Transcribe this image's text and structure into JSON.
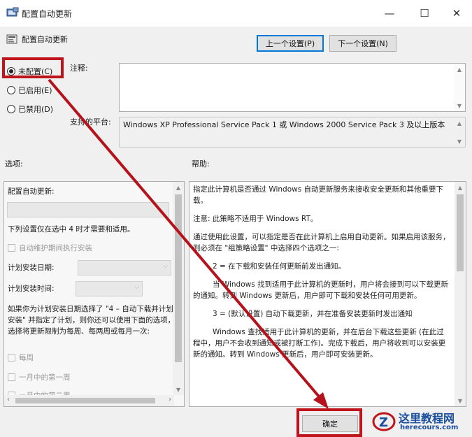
{
  "window": {
    "title": "配置自动更新",
    "minimize": "—",
    "maximize": "☐",
    "close": "✕"
  },
  "header": {
    "title": "配置自动更新",
    "prev_button": "上一个设置(P)",
    "next_button": "下一个设置(N)"
  },
  "state": {
    "not_configured": "未配置(C)",
    "enabled": "已启用(E)",
    "disabled": "已禁用(D)",
    "selected": "not_configured"
  },
  "comment": {
    "label": "注释:",
    "value": ""
  },
  "platform": {
    "label": "支持的平台:",
    "value": "Windows XP Professional Service Pack 1 或 Windows 2000 Service Pack 3 及以上版本"
  },
  "options": {
    "label": "选项:",
    "heading": "配置自动更新:",
    "note": "下列设置仅在选中 4 时才需要和适用。",
    "maintenance": "自动维护期间执行安装",
    "install_day": "计划安装日期:",
    "install_time": "计划安装时间:",
    "para": "如果你为计划安装日期选择了 \"4 – 自动下载并计划安装\" 并指定了计划，则你还可以使用下面的选项，选择将更新限制为每周、每两周或每月一次:",
    "weekly": "每周",
    "first_week": "一月中的第一周",
    "second_week": "一月中的第二周"
  },
  "help": {
    "label": "帮助:",
    "paragraphs": [
      "指定此计算机是否通过 Windows 自动更新服务来接收安全更新和其他重要下载。",
      "注意: 此策略不适用于 Windows RT。",
      "通过使用此设置，可以指定是否在此计算机上启用自动更新。如果启用该服务，则必须在 \"组策略设置\" 中选择四个选项之一:",
      "2 = 在下载和安装任何更新前发出通知。",
      "当 Windows 找到适用于此计算机的更新时，用户将会接到可以下载更新的通知。转到 Windows 更新后，用户即可下载和安装任何可用更新。",
      "3 = (默认设置) 自动下载更新，并在准备安装更新时发出通知",
      "Windows 查找适用于此计算机的更新，并在后台下载这些更新 (在此过程中，用户不会收到通知或被打断工作)。完成下载后，用户将收到可以安装更新的通知。转到 Windows 更新后，用户即可安装更新。"
    ]
  },
  "footer": {
    "ok_button": "确定"
  },
  "watermark": {
    "name": "这里教程网",
    "url": "herecours.com"
  },
  "colors": {
    "annotation_red": "#c0141c",
    "focus_blue": "#0078d7",
    "dialog_bg": "#f0f0f0"
  }
}
